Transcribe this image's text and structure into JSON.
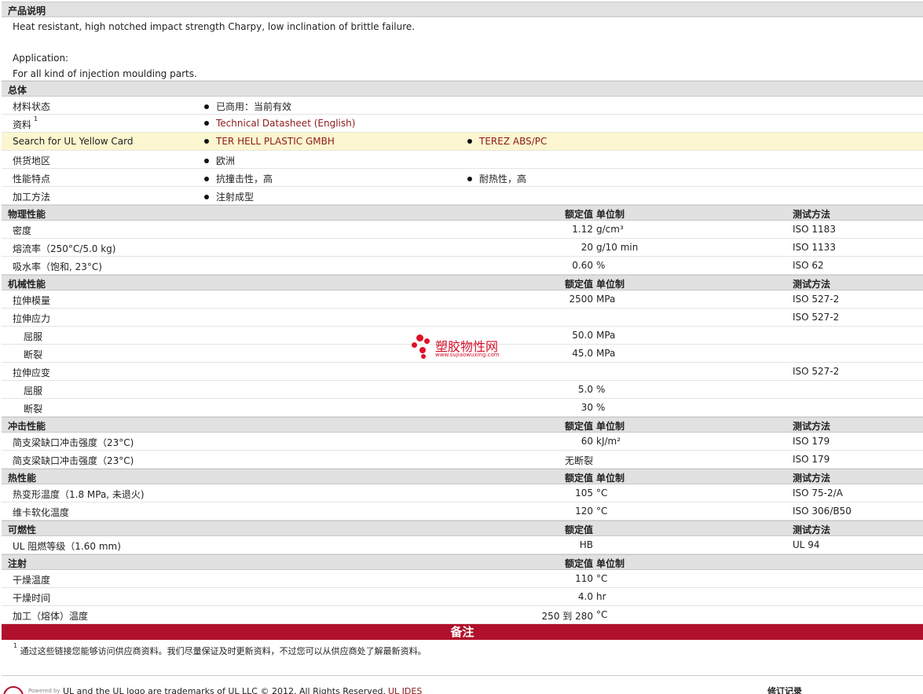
{
  "sections": {
    "desc_title": "产品说明",
    "general": "总体",
    "physical": "物理性能",
    "mechanical": "机械性能",
    "impact": "冲击性能",
    "thermal": "热性能",
    "flammability": "可燃性",
    "injection": "注射"
  },
  "headers": {
    "nominal": "额定值",
    "unit": "单位制",
    "method": "测试方法"
  },
  "description": {
    "line1": "Heat resistant, high notched impact strength Charpy, low inclination of brittle failure.",
    "line2": "Application:",
    "line3": "For all kind of injection moulding parts."
  },
  "general": {
    "status_label": "材料状态",
    "status_value": "已商用：当前有效",
    "docs_label": "资料",
    "docs_sup": "1",
    "docs_value": "Technical Datasheet (English)",
    "ul_label": "Search for UL Yellow Card",
    "ul_value1": "TER HELL PLASTIC GMBH",
    "ul_value2": "TEREZ ABS/PC",
    "region_label": "供货地区",
    "region_value": "欧洲",
    "features_label": "性能特点",
    "features_value1": "抗撞击性，高",
    "features_value2": "耐热性，高",
    "process_label": "加工方法",
    "process_value": "注射成型"
  },
  "physical": [
    {
      "label": "密度",
      "value": "1.12",
      "unit": "g/cm³",
      "method": "ISO 1183"
    },
    {
      "label": "熔流率（250°C/5.0 kg)",
      "value": "20",
      "unit": "g/10 min",
      "method": "ISO 1133"
    },
    {
      "label": "吸水率（饱和, 23°C)",
      "value": "0.60",
      "unit": "%",
      "method": "ISO 62"
    }
  ],
  "mechanical": [
    {
      "label": "拉伸模量",
      "value": "2500",
      "unit": "MPa",
      "method": "ISO 527-2",
      "sub": false
    },
    {
      "label": "拉伸应力",
      "value": "",
      "unit": "",
      "method": "ISO 527-2",
      "sub": false
    },
    {
      "label": "屈服",
      "value": "50.0",
      "unit": "MPa",
      "method": "",
      "sub": true
    },
    {
      "label": "断裂",
      "value": "45.0",
      "unit": "MPa",
      "method": "",
      "sub": true
    },
    {
      "label": "拉伸应变",
      "value": "",
      "unit": "",
      "method": "ISO 527-2",
      "sub": false
    },
    {
      "label": "屈服",
      "value": "5.0",
      "unit": "%",
      "method": "",
      "sub": true
    },
    {
      "label": "断裂",
      "value": "30",
      "unit": "%",
      "method": "",
      "sub": true
    }
  ],
  "impact": [
    {
      "label": "简支梁缺口冲击强度（23°C)",
      "value": "60",
      "unit": "kJ/m²",
      "method": "ISO 179"
    },
    {
      "label": "简支梁缺口冲击强度（23°C)",
      "value": "无断裂",
      "unit": "",
      "method": "ISO 179"
    }
  ],
  "thermal": [
    {
      "label": "热变形温度（1.8 MPa, 未退火)",
      "value": "105",
      "unit": "°C",
      "method": "ISO 75-2/A"
    },
    {
      "label": "维卡软化温度",
      "value": "120",
      "unit": "°C",
      "method": "ISO 306/B50"
    }
  ],
  "flammability": [
    {
      "label": "UL 阻燃等级（1.60 mm)",
      "value": "HB",
      "unit": "",
      "method": "UL 94"
    }
  ],
  "injection": [
    {
      "label": "干燥温度",
      "value": "110",
      "unit": "°C",
      "method": ""
    },
    {
      "label": "干燥时间",
      "value": "4.0",
      "unit": "hr",
      "method": ""
    },
    {
      "label": "加工（熔体）温度",
      "value": "250 到  280",
      "unit": "°C",
      "method": ""
    }
  ],
  "notes": {
    "title": "备注",
    "sup": "1",
    "text": "通过这些链接您能够访问供应商资料。我们尽量保证及时更新资料，不过您可以从供应商处了解最新资料。"
  },
  "footer": {
    "powered": "Powered by",
    "trademark": "UL and the UL logo are trademarks of UL LLC © 2012. All Rights Reserved.",
    "ul_link": "UL IDES",
    "revision": "修订记录"
  },
  "watermark": {
    "title": "塑胶物性网",
    "url": "www.sujiaowuxing.com"
  }
}
